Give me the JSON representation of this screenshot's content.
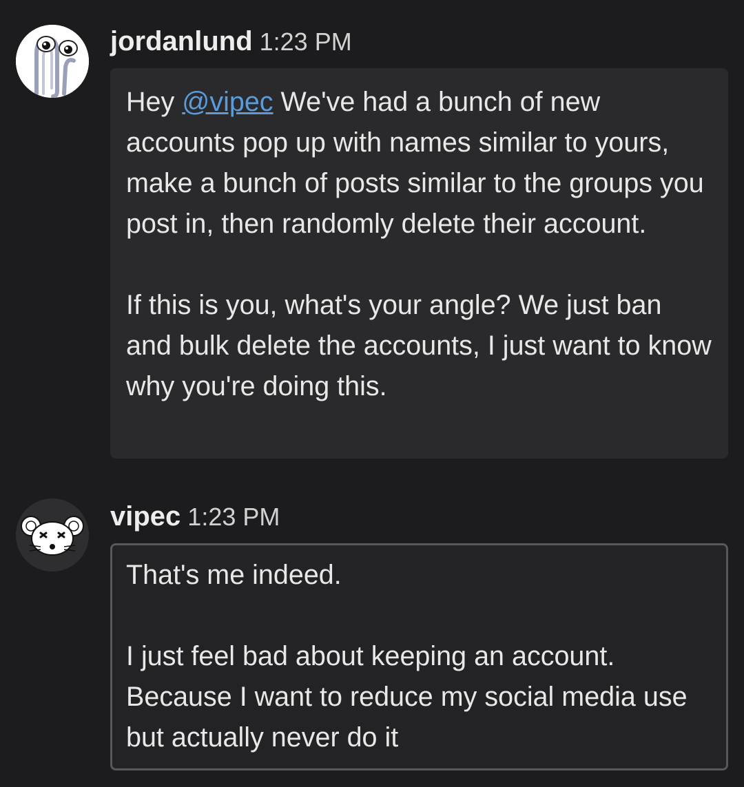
{
  "messages": [
    {
      "username": "jordanlund",
      "time": "1:23 PM",
      "avatar": "clippy-avatar",
      "body": {
        "greeting": "Hey",
        "mention": "@vipec",
        "para1_rest": "We've had a bunch of new accounts pop up with names similar to yours, make a bunch of posts similar to the groups you post in, then randomly delete their account.",
        "para2": "If this is you, what's your angle? We  just ban and bulk delete the accounts, I just want to know why you're doing this."
      }
    },
    {
      "username": "vipec",
      "time": "1:23 PM",
      "avatar": "mouse-avatar",
      "body": {
        "para1": "That's me indeed.",
        "para2": "I just feel bad about keeping an account. Because I want to reduce my social media use but actually never do it"
      }
    }
  ],
  "colors": {
    "background": "#1c1c1e",
    "bubble": "#2a2a2c",
    "mention": "#5b9bd9",
    "outline": "#56585c"
  }
}
